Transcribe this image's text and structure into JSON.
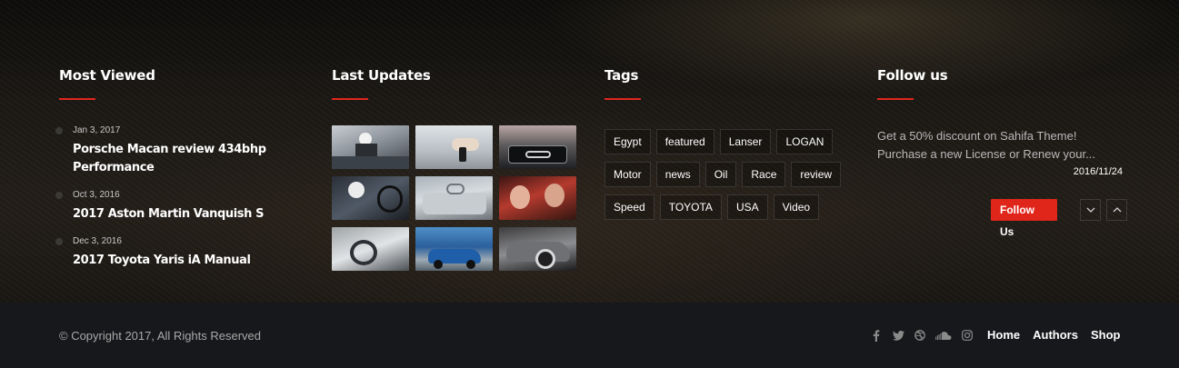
{
  "most_viewed": {
    "title": "Most Viewed",
    "items": [
      {
        "date": "Jan 3, 2017",
        "title": "Porsche Macan review 434bhp Performance"
      },
      {
        "date": "Oct 3, 2016",
        "title": "2017 Aston Martin Vanquish S"
      },
      {
        "date": "Dec 3, 2016",
        "title": "2017 Toyota Yaris iA Manual"
      }
    ]
  },
  "last_updates": {
    "title": "Last Updates"
  },
  "tags": {
    "title": "Tags",
    "items": [
      "Egypt",
      "featured",
      "Lanser",
      "LOGAN",
      "Motor",
      "news",
      "Oil",
      "Race",
      "review",
      "Speed",
      "TOYOTA",
      "USA",
      "Video"
    ]
  },
  "follow": {
    "title": "Follow us",
    "text": "Get a 50% discount on Sahifa Theme! Purchase a new License or Renew your...",
    "date": "2016/11/24",
    "button": "Follow Us"
  },
  "footer": {
    "copyright": "© Copyright 2017, All Rights Reserved",
    "social": [
      "facebook-icon",
      "twitter-icon",
      "dribbble-icon",
      "soundcloud-icon",
      "instagram-icon"
    ],
    "nav": [
      "Home",
      "Authors",
      "Shop"
    ]
  },
  "colors": {
    "accent": "#e0261b",
    "bottom_bar": "#17181b"
  }
}
